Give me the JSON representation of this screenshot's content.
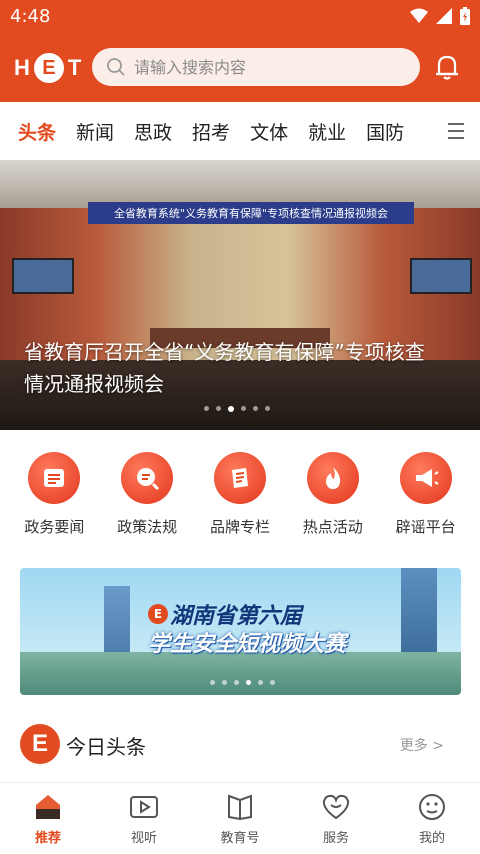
{
  "status": {
    "time": "4:48"
  },
  "header": {
    "logo": {
      "h": "H",
      "e": "E",
      "t": "T"
    },
    "search_placeholder": "请输入搜索内容"
  },
  "tabs": [
    {
      "label": "头条",
      "active": true
    },
    {
      "label": "新闻"
    },
    {
      "label": "思政"
    },
    {
      "label": "招考"
    },
    {
      "label": "文体"
    },
    {
      "label": "就业"
    },
    {
      "label": "国防"
    }
  ],
  "banner": {
    "sign": "全省教育系统\"义务教育有保障\"专项核查情况通报视频会",
    "caption": "省教育厅召开全省“义务教育有保障”专项核查情况通报视频会"
  },
  "quick_menu": [
    {
      "label": "政务要闻",
      "icon": "news-icon"
    },
    {
      "label": "政策法规",
      "icon": "policy-search-icon"
    },
    {
      "label": "品牌专栏",
      "icon": "brand-column-icon"
    },
    {
      "label": "热点活动",
      "icon": "flame-icon"
    },
    {
      "label": "辟谣平台",
      "icon": "megaphone-icon"
    }
  ],
  "promo": {
    "line1": "湖南省第六届",
    "line2": "学生安全短视频大赛",
    "badge": "E"
  },
  "section": {
    "icon_letter": "E",
    "title": "今日头条",
    "more": "更多 >"
  },
  "bottom_nav": [
    {
      "label": "推荐",
      "icon": "home-icon",
      "active": true
    },
    {
      "label": "视听",
      "icon": "video-icon"
    },
    {
      "label": "教育号",
      "icon": "book-icon"
    },
    {
      "label": "服务",
      "icon": "heart-icon"
    },
    {
      "label": "我的",
      "icon": "profile-face-icon"
    }
  ],
  "colors": {
    "accent": "#e24a1f",
    "search_bg": "#fbeee9"
  }
}
